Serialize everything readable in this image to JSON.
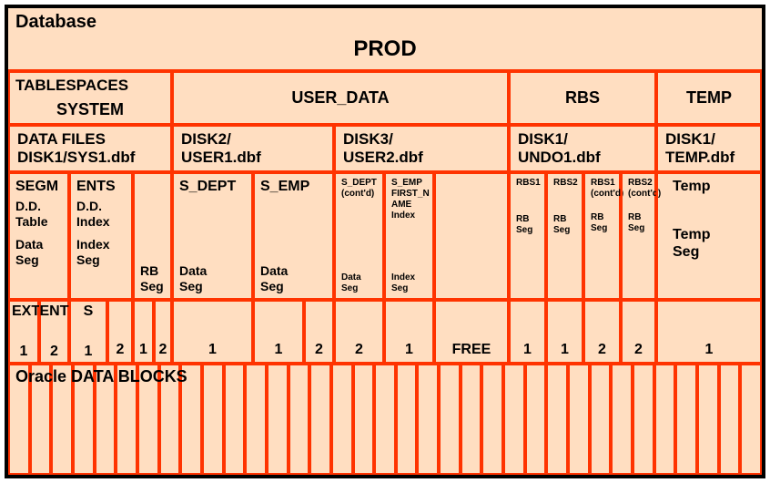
{
  "database": {
    "label": "Database",
    "name": "PROD"
  },
  "tablespaces": {
    "label": "TABLESPACES",
    "items": [
      "SYSTEM",
      "USER_DATA",
      "RBS",
      "TEMP"
    ]
  },
  "datafiles": {
    "label": "DATA FILES",
    "items": [
      "DISK1/SYS1.dbf",
      "DISK2/\nUSER1.dbf",
      "DISK3/\nUSER2.dbf",
      "DISK1/\nUNDO1.dbf",
      "DISK1/\nTEMP.dbf"
    ]
  },
  "segments": {
    "label": "SEGMENTS",
    "items": [
      {
        "line1": "D.D.",
        "line2": "Table",
        "line3": "Data",
        "line4": "Seg"
      },
      {
        "line1": "D.D.",
        "line2": "Index",
        "line3": "Index",
        "line4": "Seg"
      },
      {
        "line1": "RB",
        "line2": "Seg"
      },
      {
        "name": "S_DEPT",
        "line1": "Data",
        "line2": "Seg"
      },
      {
        "name": "S_EMP",
        "line1": "Data",
        "line2": "Seg"
      },
      {
        "name1": "S_DEPT",
        "name2": "(cont'd)",
        "line1": "Data",
        "line2": "Seg"
      },
      {
        "name1": "S_EMP",
        "name2": "FIRST_N",
        "name3": "AME",
        "name4": "Index",
        "line1": "Index",
        "line2": "Seg"
      },
      {
        "name": "RBS1",
        "line1": "RB",
        "line2": "Seg"
      },
      {
        "name": "RBS2",
        "line1": "RB",
        "line2": "Seg"
      },
      {
        "name1": "RBS1",
        "name2": "(cont'd)",
        "line1": "RB",
        "line2": "Seg"
      },
      {
        "name1": "RBS2",
        "name2": "(cont'd)",
        "line1": "RB",
        "line2": "Seg"
      },
      {
        "name": "Temp",
        "line1": "Temp",
        "line2": "Seg"
      }
    ]
  },
  "extents": {
    "label": "EXTENTS",
    "items": [
      "1",
      "2",
      "1",
      "2",
      "1",
      "2",
      "1",
      "1",
      "2",
      "2",
      "1",
      "FREE",
      "1",
      "1",
      "2",
      "2",
      "1"
    ]
  },
  "datablocks": {
    "label": "Oracle DATA BLOCKS"
  }
}
